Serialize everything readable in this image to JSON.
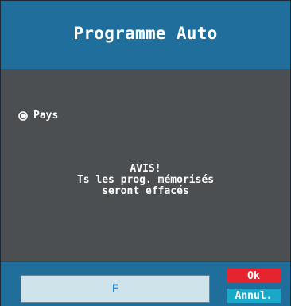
{
  "header": {
    "title": "Programme Auto"
  },
  "options": [
    {
      "label": "Pays",
      "selected": true
    }
  ],
  "notice": {
    "line1": "AVIS!",
    "line2": "Ts les prog. mémorisés",
    "line3": "seront effacés"
  },
  "footer": {
    "input_value": "F",
    "ok_label": "Ok",
    "cancel_label": "Annul."
  },
  "colors": {
    "header_bg": "#1f6e9c",
    "body_bg": "#4c4f52",
    "ok_bg": "#e52430",
    "cancel_bg": "#1aa8c8",
    "input_text": "#2b86c7"
  }
}
